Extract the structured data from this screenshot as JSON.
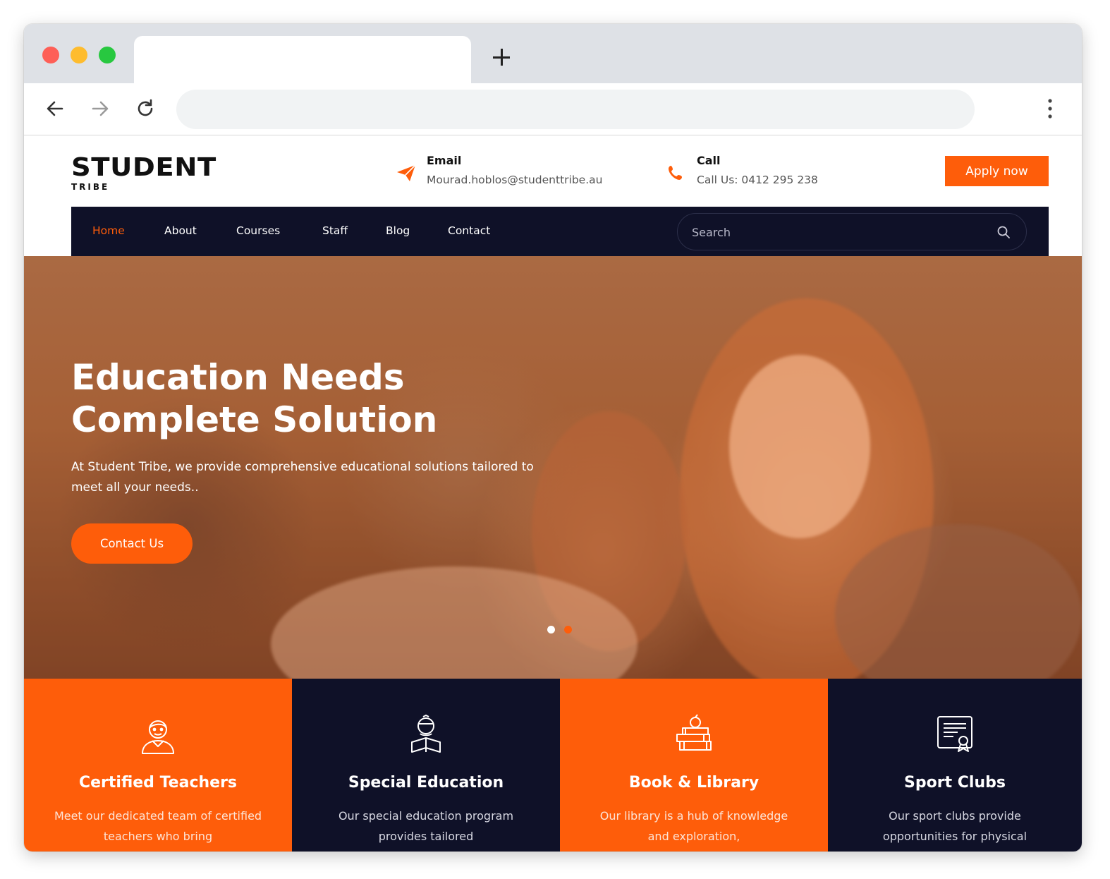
{
  "colors": {
    "accent": "#fe5d0a",
    "navy": "#0f1128"
  },
  "browser": {
    "new_tab_label": "+"
  },
  "header": {
    "logo_main": "STUDENT",
    "logo_sub": "TRIBE",
    "email_label": "Email",
    "email_value": "Mourad.hoblos@studenttribe.au",
    "call_label": "Call",
    "call_value": "Call Us: 0412 295 238",
    "apply_label": "Apply now"
  },
  "nav": {
    "items": [
      {
        "label": "Home"
      },
      {
        "label": "About"
      },
      {
        "label": "Courses"
      },
      {
        "label": "Staff"
      },
      {
        "label": "Blog"
      },
      {
        "label": "Contact"
      }
    ],
    "search_placeholder": "Search"
  },
  "hero": {
    "title_line1": "Education Needs",
    "title_line2": "Complete Solution",
    "text": "At Student Tribe, we provide comprehensive educational solutions tailored to meet all your needs..",
    "button_label": "Contact Us"
  },
  "features": [
    {
      "icon": "teacher-icon",
      "title": "Certified Teachers",
      "text": "Meet our dedicated team of certified teachers who bring"
    },
    {
      "icon": "student-reading-icon",
      "title": "Special Education",
      "text": "Our special education program provides tailored"
    },
    {
      "icon": "books-apple-icon",
      "title": "Book & Library",
      "text": "Our library is a hub of knowledge and exploration,"
    },
    {
      "icon": "certificate-icon",
      "title": "Sport Clubs",
      "text": "Our sport clubs provide opportunities for physical"
    }
  ]
}
